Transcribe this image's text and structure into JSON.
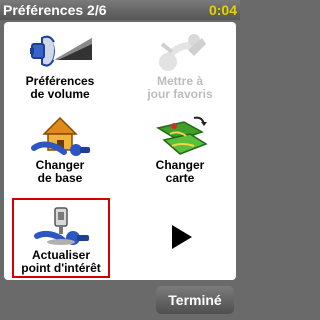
{
  "header": {
    "title": "Préférences 2/6",
    "time": "0:04"
  },
  "menu": {
    "items": [
      {
        "label": "Préférences\nde volume",
        "icon": "volume-speaker-icon",
        "enabled": true,
        "selected": false
      },
      {
        "label": "Mettre à\njour favoris",
        "icon": "favorites-update-icon",
        "enabled": false,
        "selected": false
      },
      {
        "label": "Changer\nde base",
        "icon": "home-base-icon",
        "enabled": true,
        "selected": false
      },
      {
        "label": "Changer\ncarte",
        "icon": "change-map-icon",
        "enabled": true,
        "selected": false
      },
      {
        "label": "Actualiser\npoint d'intérêt",
        "icon": "poi-update-icon",
        "enabled": true,
        "selected": true
      }
    ],
    "next_icon": "right-arrow-icon"
  },
  "footer": {
    "done_label": "Terminé"
  },
  "colors": {
    "selection": "#d40000",
    "clock": "#e6d200",
    "disabled_text": "#bdbdbd"
  }
}
